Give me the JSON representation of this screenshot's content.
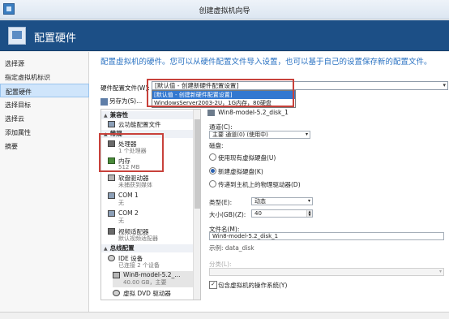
{
  "window": {
    "title": "创建虚拟机向导"
  },
  "header": {
    "title": "配置硬件"
  },
  "nav": {
    "items": [
      {
        "label": "选择源"
      },
      {
        "label": "指定虚拟机标识"
      },
      {
        "label": "配置硬件"
      },
      {
        "label": "选择目标"
      },
      {
        "label": "选择云"
      },
      {
        "label": "添加属性"
      },
      {
        "label": "摘要"
      }
    ]
  },
  "main": {
    "description": "配置虚拟机的硬件。您可以从硬件配置文件导入设置，也可以基于自己的设置保存新的配置文件。",
    "profile_label": "硬件配置文件(W):",
    "profile_value": "[默认值 - 创建新硬件配置设置]",
    "profile_options": [
      "[默认值 - 创建新硬件配置设置]",
      "WindowsServer2003-2U，1G内存，80硬盘"
    ],
    "save_as_label": "另存为(S)..."
  },
  "tree": {
    "compat_header": "兼容性",
    "compat_item": "云功能配置文件",
    "general_header": "常规",
    "processor": {
      "label": "处理器",
      "sub": "1 个处理器"
    },
    "memory": {
      "label": "内存",
      "sub": "512 MB"
    },
    "floppy": {
      "label": "软盘驱动器",
      "sub": "未捕获到媒体"
    },
    "com1": {
      "label": "COM 1",
      "sub": "无"
    },
    "com2": {
      "label": "COM 2",
      "sub": "无"
    },
    "video": {
      "label": "视频适配器",
      "sub": "默认视频适配器"
    },
    "bus_header": "总线配置",
    "ide": {
      "label": "IDE 设备",
      "sub": "已连接 2 个设备"
    },
    "disk": {
      "label": "Win8-model-5.2_...",
      "sub": "40.00 GB，主要"
    },
    "dvd": {
      "label": "虚拟 DVD 驱动器"
    }
  },
  "disk_panel": {
    "header": "Win8-model-5.2_disk_1",
    "channel_label": "通道(C):",
    "channel_value": "主要 通道(0) (使用中)",
    "disk_label": "磁盘:",
    "radio_existing": "使用现有虚拟硬盘(U)",
    "radio_new": "新建虚拟硬盘(K)",
    "radio_passthrough": "传递到主机上的物理驱动器(D)",
    "type_label": "类型(E):",
    "type_value": "动态",
    "size_label": "大小(GB)(Z):",
    "size_value": "40",
    "filename_label": "文件名(M):",
    "filename_value": "Win8-model-5.2_disk_1",
    "example_label": "示例: data_disk",
    "classification_label": "分类(L):",
    "include_os_label": "包含虚拟机的操作系统(Y)"
  }
}
